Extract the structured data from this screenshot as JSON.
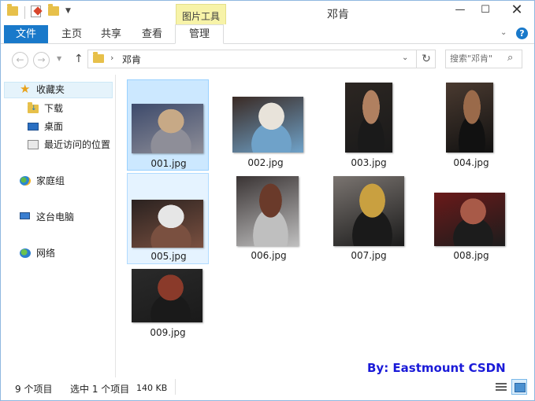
{
  "window": {
    "title": "邓肯",
    "contextual_tab_group": "图片工具",
    "controls": {
      "minimize": "—",
      "maximize": "☐",
      "close": "✕"
    }
  },
  "ribbon": {
    "file_tab": "文件",
    "tabs": [
      "主页",
      "共享",
      "查看",
      "管理"
    ],
    "active_tab": "管理",
    "accent_color": "#1979ca",
    "help": "?"
  },
  "address": {
    "path": [
      "邓肯"
    ],
    "separator": "›",
    "search_placeholder": "搜索\"邓肯\""
  },
  "nav_pane": {
    "favorites": {
      "label": "收藏夹",
      "icon": "star-icon"
    },
    "favorite_items": [
      {
        "label": "下载",
        "icon": "download-folder-icon"
      },
      {
        "label": "桌面",
        "icon": "desktop-icon"
      },
      {
        "label": "最近访问的位置",
        "icon": "recent-places-icon"
      }
    ],
    "homegroup": {
      "label": "家庭组",
      "icon": "homegroup-icon"
    },
    "this_pc": {
      "label": "这台电脑",
      "icon": "computer-icon"
    },
    "network": {
      "label": "网络",
      "icon": "network-icon"
    }
  },
  "files": [
    {
      "name": "001.jpg",
      "state": "selected",
      "palette": [
        "#3d4a6b",
        "#8e8e98",
        "#c7a986"
      ]
    },
    {
      "name": "002.jpg",
      "state": "normal",
      "palette": [
        "#3a2a24",
        "#6fa2c9",
        "#e8e3da"
      ]
    },
    {
      "name": "003.jpg",
      "state": "normal",
      "palette": [
        "#2c2622",
        "#1a1a1a",
        "#b08060"
      ]
    },
    {
      "name": "004.jpg",
      "state": "normal",
      "palette": [
        "#4a3a30",
        "#111111",
        "#9a6a4a"
      ]
    },
    {
      "name": "005.jpg",
      "state": "hover",
      "palette": [
        "#2a2220",
        "#7a5040",
        "#e6e6e6"
      ]
    },
    {
      "name": "006.jpg",
      "state": "normal",
      "palette": [
        "#3a3434",
        "#bfbfbf",
        "#6a3a2a"
      ]
    },
    {
      "name": "007.jpg",
      "state": "normal",
      "palette": [
        "#7a7470",
        "#1a1a1a",
        "#c9a040"
      ]
    },
    {
      "name": "008.jpg",
      "state": "normal",
      "palette": [
        "#6a1a1a",
        "#1c1c1c",
        "#a85a48"
      ]
    },
    {
      "name": "009.jpg",
      "state": "normal",
      "palette": [
        "#2a2a2a",
        "#1a1a1a",
        "#8a3a2a"
      ]
    }
  ],
  "status": {
    "item_count": "9 个项目",
    "selection": "选中 1 个项目",
    "size": "140 KB"
  },
  "watermark": "By: Eastmount CSDN"
}
